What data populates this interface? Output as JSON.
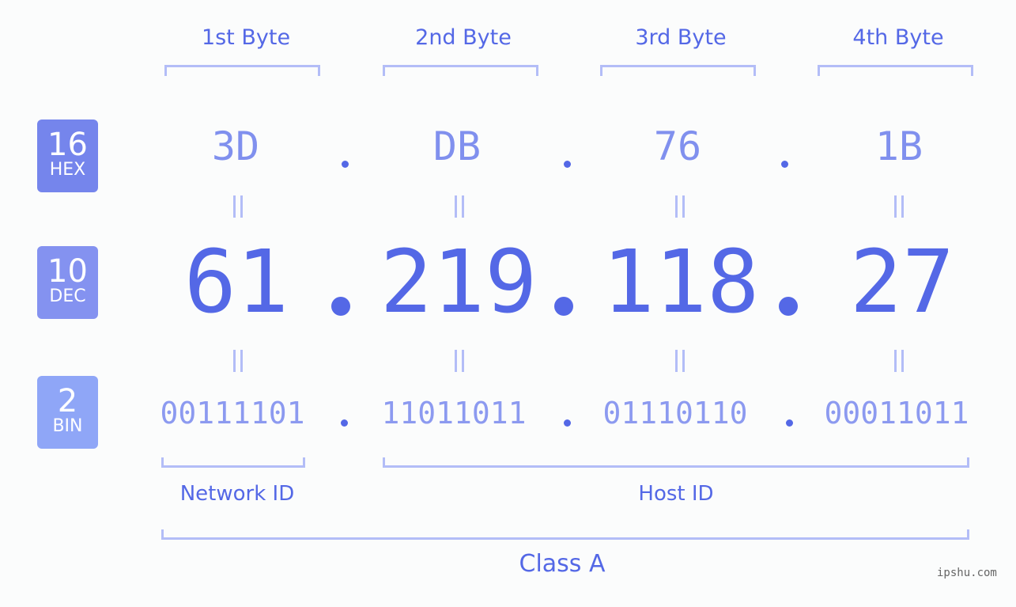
{
  "bytes": [
    {
      "label": "1st Byte",
      "hex": "3D",
      "dec": "61",
      "bin": "00111101"
    },
    {
      "label": "2nd Byte",
      "hex": "DB",
      "dec": "219",
      "bin": "11011011"
    },
    {
      "label": "3rd Byte",
      "hex": "76",
      "dec": "118",
      "bin": "01110110"
    },
    {
      "label": "4th Byte",
      "hex": "1B",
      "dec": "27",
      "bin": "00011011"
    }
  ],
  "badges": {
    "hex": {
      "num": "16",
      "unit": "HEX",
      "color": "#7585ec"
    },
    "dec": {
      "num": "10",
      "unit": "DEC",
      "color": "#8492f0"
    },
    "bin": {
      "num": "2",
      "unit": "BIN",
      "color": "#8fa6f7"
    }
  },
  "labels": {
    "network_id": "Network ID",
    "host_id": "Host ID",
    "class": "Class A"
  },
  "watermark": "ipshu.com",
  "colors": {
    "primary": "#5468e6",
    "bracket": "#b3bdf7"
  }
}
